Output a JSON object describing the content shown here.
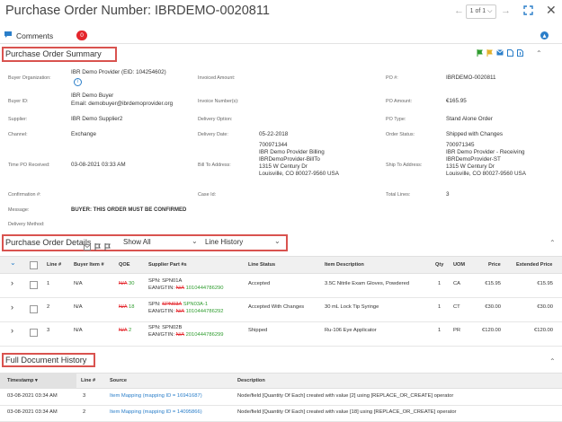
{
  "header": {
    "title": "Purchase Order Number: IBRDEMO-0020811",
    "pager": "1 of 1 ⌵",
    "prev_icon": "←",
    "next_icon": "→"
  },
  "comments": {
    "label": "Comments",
    "count": "0"
  },
  "summary": {
    "title": "Purchase Order Summary",
    "buyer_org_label": "Buyer Organization:",
    "buyer_org_value": "IBR Demo Provider (EID: 104254602)",
    "info_icon": "i",
    "invoiced_amount_label": "Invoiced Amount:",
    "po_num_label": "PO #:",
    "po_num_value": "IBRDEMO-0020811",
    "buyer_id_label": "Buyer ID:",
    "buyer_id_value1": "IBR Demo Buyer",
    "buyer_id_value2": "Email: demobuyer@ibrdemoprovider.org",
    "invoice_numbers_label": "Invoice Number(s):",
    "po_amount_label": "PO Amount:",
    "po_amount_value": "€165.95",
    "supplier_label": "Supplier:",
    "supplier_value": "IBR Demo Supplier2",
    "delivery_option_label": "Delivery Option:",
    "po_type_label": "PO Type:",
    "po_type_value": "Stand Alone Order",
    "channel_label": "Channel:",
    "channel_value": "Exchange",
    "delivery_date_label": "Delivery Date:",
    "delivery_date_value": "05-22-2018",
    "order_status_label": "Order Status:",
    "order_status_value": "Shipped with Changes",
    "time_received_label": "Time PO Received:",
    "time_received_value": "03-08-2021 03:33 AM",
    "bill_to_label": "Bill To Address:",
    "bill_to_lines": [
      "700971344",
      "IBR Demo Provider Billing",
      "IBRDemoProvider-BillTo",
      "1315 W Century Dr",
      "Louisville, CO 80027-9560 USA"
    ],
    "ship_to_label": "Ship To Address:",
    "ship_to_lines": [
      "700971345",
      "IBR Demo Provider - Receiving",
      "IBRDemoProvider-ST",
      "1315 W Century Dr",
      "Louisville, CO 80027-9560 USA"
    ],
    "confirmation_label": "Confirmation #:",
    "case_id_label": "Case Id:",
    "total_lines_label": "Total Lines:",
    "total_lines_value": "3",
    "message_label": "Message:",
    "message_value": "BUYER:  THIS ORDER MUST BE CONFIRMED",
    "delivery_method_label": "Delivery Method:"
  },
  "details": {
    "title": "Purchase Order Details",
    "show_all": "Show All",
    "line_history": "Line History",
    "columns": {
      "line": "Line #",
      "buyer_item": "Buyer Item #",
      "qoe": "QOE",
      "supplier_part": "Supplier Part #s",
      "line_status": "Line Status",
      "item_desc": "Item Description",
      "qty": "Qty",
      "uom": "UOM",
      "price": "Price",
      "ext_price": "Extended Price"
    },
    "rows": [
      {
        "line": "1",
        "buyer_item": "N/A",
        "qoe_old": "N/A",
        "qoe_new": "30",
        "spn_label": "SPN: ",
        "spn_old": "",
        "spn_new": "",
        "spn_plain": "SPN01A",
        "ean_label": "EAN/GTIN: ",
        "ean_old": "N/A",
        "ean_new": "1010444786290",
        "status": "Accepted",
        "desc": "3.5C Nitrile Exam Gloves, Powdered",
        "qty": "1",
        "uom": "CA",
        "price": "€15.95",
        "ext": "€15.95"
      },
      {
        "line": "2",
        "buyer_item": "N/A",
        "qoe_old": "N/A",
        "qoe_new": "18",
        "spn_label": "SPN: ",
        "spn_old": "SPN03A",
        "spn_new": "SPN03A-1",
        "spn_plain": "",
        "ean_label": "EAN/GTIN: ",
        "ean_old": "N/A",
        "ean_new": "1010444786292",
        "status": "Accepted With Changes",
        "desc": "30 mL Lock Tip Syringe",
        "qty": "1",
        "uom": "CT",
        "price": "€30.00",
        "ext": "€30.00"
      },
      {
        "line": "3",
        "buyer_item": "N/A",
        "qoe_old": "N/A",
        "qoe_new": "2",
        "spn_label": "SPN: ",
        "spn_old": "",
        "spn_new": "",
        "spn_plain": "SPN02B",
        "ean_label": "EAN/GTIN: ",
        "ean_old": "N/A",
        "ean_new": "2010444786299",
        "status": "Shipped",
        "desc": "Ru-106 Eye Applicator",
        "qty": "1",
        "uom": "PR",
        "price": "€120.00",
        "ext": "€120.00"
      }
    ]
  },
  "history": {
    "title": "Full Document History",
    "columns": {
      "timestamp": "Timestamp",
      "sort_arrow": "▾",
      "line": "Line #",
      "source": "Source",
      "description": "Description"
    },
    "rows": [
      {
        "timestamp": "03-08-2021 03:34 AM",
        "line": "3",
        "source": "Item Mapping (mapping ID = 16941687)",
        "description": "Node/field [Quantity Of Each] created with value [2] using [REPLACE_OR_CREATE] operator"
      },
      {
        "timestamp": "03-08-2021 03:34 AM",
        "line": "2",
        "source": "Item Mapping (mapping ID = 14095866)",
        "description": "Node/field [Quantity Of Each] created with value [18] using [REPLACE_OR_CREATE] operator"
      }
    ]
  },
  "colors": {
    "accent": "#2a7ec9",
    "highlight_box": "#d9534f",
    "strike_red": "#e4262c",
    "new_green": "#2e9c2e"
  }
}
